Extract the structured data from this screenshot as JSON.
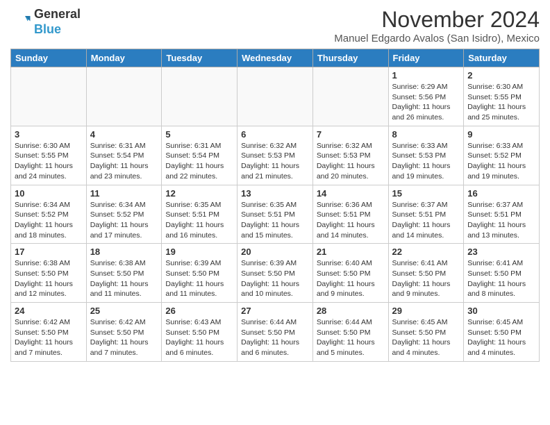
{
  "header": {
    "logo_general": "General",
    "logo_blue": "Blue",
    "title": "November 2024",
    "subtitle": "Manuel Edgardo Avalos (San Isidro), Mexico"
  },
  "weekdays": [
    "Sunday",
    "Monday",
    "Tuesday",
    "Wednesday",
    "Thursday",
    "Friday",
    "Saturday"
  ],
  "weeks": [
    [
      {
        "day": "",
        "info": ""
      },
      {
        "day": "",
        "info": ""
      },
      {
        "day": "",
        "info": ""
      },
      {
        "day": "",
        "info": ""
      },
      {
        "day": "",
        "info": ""
      },
      {
        "day": "1",
        "info": "Sunrise: 6:29 AM\nSunset: 5:56 PM\nDaylight: 11 hours\nand 26 minutes."
      },
      {
        "day": "2",
        "info": "Sunrise: 6:30 AM\nSunset: 5:55 PM\nDaylight: 11 hours\nand 25 minutes."
      }
    ],
    [
      {
        "day": "3",
        "info": "Sunrise: 6:30 AM\nSunset: 5:55 PM\nDaylight: 11 hours\nand 24 minutes."
      },
      {
        "day": "4",
        "info": "Sunrise: 6:31 AM\nSunset: 5:54 PM\nDaylight: 11 hours\nand 23 minutes."
      },
      {
        "day": "5",
        "info": "Sunrise: 6:31 AM\nSunset: 5:54 PM\nDaylight: 11 hours\nand 22 minutes."
      },
      {
        "day": "6",
        "info": "Sunrise: 6:32 AM\nSunset: 5:53 PM\nDaylight: 11 hours\nand 21 minutes."
      },
      {
        "day": "7",
        "info": "Sunrise: 6:32 AM\nSunset: 5:53 PM\nDaylight: 11 hours\nand 20 minutes."
      },
      {
        "day": "8",
        "info": "Sunrise: 6:33 AM\nSunset: 5:53 PM\nDaylight: 11 hours\nand 19 minutes."
      },
      {
        "day": "9",
        "info": "Sunrise: 6:33 AM\nSunset: 5:52 PM\nDaylight: 11 hours\nand 19 minutes."
      }
    ],
    [
      {
        "day": "10",
        "info": "Sunrise: 6:34 AM\nSunset: 5:52 PM\nDaylight: 11 hours\nand 18 minutes."
      },
      {
        "day": "11",
        "info": "Sunrise: 6:34 AM\nSunset: 5:52 PM\nDaylight: 11 hours\nand 17 minutes."
      },
      {
        "day": "12",
        "info": "Sunrise: 6:35 AM\nSunset: 5:51 PM\nDaylight: 11 hours\nand 16 minutes."
      },
      {
        "day": "13",
        "info": "Sunrise: 6:35 AM\nSunset: 5:51 PM\nDaylight: 11 hours\nand 15 minutes."
      },
      {
        "day": "14",
        "info": "Sunrise: 6:36 AM\nSunset: 5:51 PM\nDaylight: 11 hours\nand 14 minutes."
      },
      {
        "day": "15",
        "info": "Sunrise: 6:37 AM\nSunset: 5:51 PM\nDaylight: 11 hours\nand 14 minutes."
      },
      {
        "day": "16",
        "info": "Sunrise: 6:37 AM\nSunset: 5:51 PM\nDaylight: 11 hours\nand 13 minutes."
      }
    ],
    [
      {
        "day": "17",
        "info": "Sunrise: 6:38 AM\nSunset: 5:50 PM\nDaylight: 11 hours\nand 12 minutes."
      },
      {
        "day": "18",
        "info": "Sunrise: 6:38 AM\nSunset: 5:50 PM\nDaylight: 11 hours\nand 11 minutes."
      },
      {
        "day": "19",
        "info": "Sunrise: 6:39 AM\nSunset: 5:50 PM\nDaylight: 11 hours\nand 11 minutes."
      },
      {
        "day": "20",
        "info": "Sunrise: 6:39 AM\nSunset: 5:50 PM\nDaylight: 11 hours\nand 10 minutes."
      },
      {
        "day": "21",
        "info": "Sunrise: 6:40 AM\nSunset: 5:50 PM\nDaylight: 11 hours\nand 9 minutes."
      },
      {
        "day": "22",
        "info": "Sunrise: 6:41 AM\nSunset: 5:50 PM\nDaylight: 11 hours\nand 9 minutes."
      },
      {
        "day": "23",
        "info": "Sunrise: 6:41 AM\nSunset: 5:50 PM\nDaylight: 11 hours\nand 8 minutes."
      }
    ],
    [
      {
        "day": "24",
        "info": "Sunrise: 6:42 AM\nSunset: 5:50 PM\nDaylight: 11 hours\nand 7 minutes."
      },
      {
        "day": "25",
        "info": "Sunrise: 6:42 AM\nSunset: 5:50 PM\nDaylight: 11 hours\nand 7 minutes."
      },
      {
        "day": "26",
        "info": "Sunrise: 6:43 AM\nSunset: 5:50 PM\nDaylight: 11 hours\nand 6 minutes."
      },
      {
        "day": "27",
        "info": "Sunrise: 6:44 AM\nSunset: 5:50 PM\nDaylight: 11 hours\nand 6 minutes."
      },
      {
        "day": "28",
        "info": "Sunrise: 6:44 AM\nSunset: 5:50 PM\nDaylight: 11 hours\nand 5 minutes."
      },
      {
        "day": "29",
        "info": "Sunrise: 6:45 AM\nSunset: 5:50 PM\nDaylight: 11 hours\nand 4 minutes."
      },
      {
        "day": "30",
        "info": "Sunrise: 6:45 AM\nSunset: 5:50 PM\nDaylight: 11 hours\nand 4 minutes."
      }
    ]
  ]
}
